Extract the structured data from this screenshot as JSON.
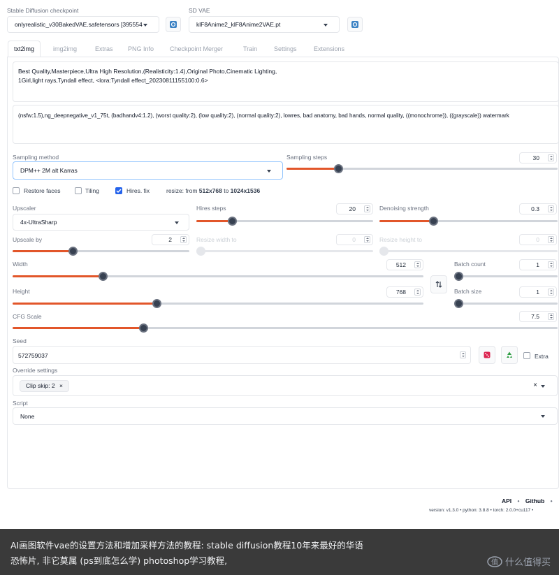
{
  "header": {
    "checkpoint_label": "Stable Diffusion checkpoint",
    "checkpoint_value": "onlyrealistic_v30BakedVAE.safetensors [395554",
    "vae_label": "SD VAE",
    "vae_value": "klF8Anime2_klF8Anime2VAE.pt"
  },
  "tabs": [
    "txt2img",
    "img2img",
    "Extras",
    "PNG Info",
    "Checkpoint Merger",
    "Train",
    "Settings",
    "Extensions"
  ],
  "prompt": {
    "line1": "Best Quality,Masterpiece,Ultra High Resolution,(Realisticity:1.4),Original Photo,Cinematic Lighting,",
    "line2": "1Girl,light rays,Tyndall effect, <lora:Tyndall effect_20230811155100:0.6>"
  },
  "negative_prompt": "(nsfw:1.5),ng_deepnegative_v1_75t, (badhandv4:1.2), (worst quality:2), (low quality:2), (normal quality:2), lowres, bad anatomy, bad hands, normal quality, ((monochrome)), ((grayscale)) watermark",
  "sampling": {
    "method_label": "Sampling method",
    "method_value": "DPM++ 2M alt Karras",
    "steps_label": "Sampling steps",
    "steps_value": "30",
    "steps_fraction": 0.19
  },
  "checkboxes": {
    "restore_faces": "Restore faces",
    "tiling": "Tiling",
    "hires_fix": "Hires. fix",
    "resize_prefix": "resize: from ",
    "resize_from": "512x768",
    "resize_to_word": " to ",
    "resize_to": "1024x1536"
  },
  "hires": {
    "upscaler_label": "Upscaler",
    "upscaler_value": "4x-UltraSharp",
    "hires_steps_label": "Hires steps",
    "hires_steps_value": "20",
    "hires_steps_fraction": 0.2,
    "denoise_label": "Denoising strength",
    "denoise_value": "0.3",
    "denoise_fraction": 0.3,
    "upscale_by_label": "Upscale by",
    "upscale_by_value": "2",
    "upscale_by_fraction": 0.34,
    "resize_width_label": "Resize width to",
    "resize_width_value": "0",
    "resize_height_label": "Resize height to",
    "resize_height_value": "0"
  },
  "dimensions": {
    "width_label": "Width",
    "width_value": "512",
    "width_fraction": 0.22,
    "height_label": "Height",
    "height_value": "768",
    "height_fraction": 0.35,
    "swap_icon": "swap-arrows-icon",
    "batch_count_label": "Batch count",
    "batch_count_value": "1",
    "batch_size_label": "Batch size",
    "batch_size_value": "1"
  },
  "cfg": {
    "label": "CFG Scale",
    "value": "7.5",
    "fraction": 0.24
  },
  "seed": {
    "label": "Seed",
    "value": "572759037",
    "extra_label": "Extra",
    "dice_icon": "dice-icon",
    "recycle_icon": "recycle-icon"
  },
  "override": {
    "label": "Override settings",
    "chip": "Clip skip: 2",
    "chip_close": "×",
    "clear": "×"
  },
  "script": {
    "label": "Script",
    "value": "None"
  },
  "footer": {
    "api": "API",
    "github": "Github",
    "sep": "•",
    "version": "version: v1.3.0  •  python: 3.8.8  •  torch: 2.0.0+cu117  •"
  },
  "caption": {
    "line1": "AI画图软件vae的设置方法和增加采样方法的教程: stable diffusion教程10年来最好的华语",
    "line2": "恐怖片, 非它莫属 (ps到底怎么学) photoshop学习教程,",
    "watermark": "什么值得买"
  },
  "colors": {
    "accent": "#e2562a",
    "refresh": "#3b82c4",
    "checkbox_on": "#2563eb",
    "caption_bg": "#3a3a3a"
  }
}
